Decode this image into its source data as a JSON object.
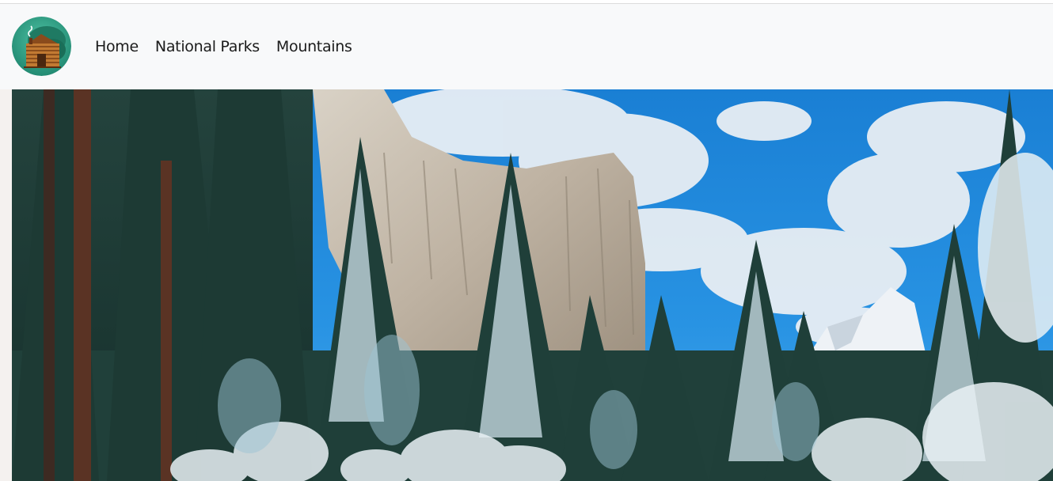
{
  "navbar": {
    "logo_icon": "log-cabin-icon",
    "links": [
      {
        "label": "Home"
      },
      {
        "label": "National Parks"
      },
      {
        "label": "Mountains"
      }
    ]
  },
  "hero": {
    "subject": "snow-covered pine forest below a granite cliff in winter"
  },
  "colors": {
    "navbar_background": "#f8f9fa",
    "nav_text": "#1b1b1b",
    "logo_background": "#2e9e86",
    "sky": "#1e88d8"
  }
}
